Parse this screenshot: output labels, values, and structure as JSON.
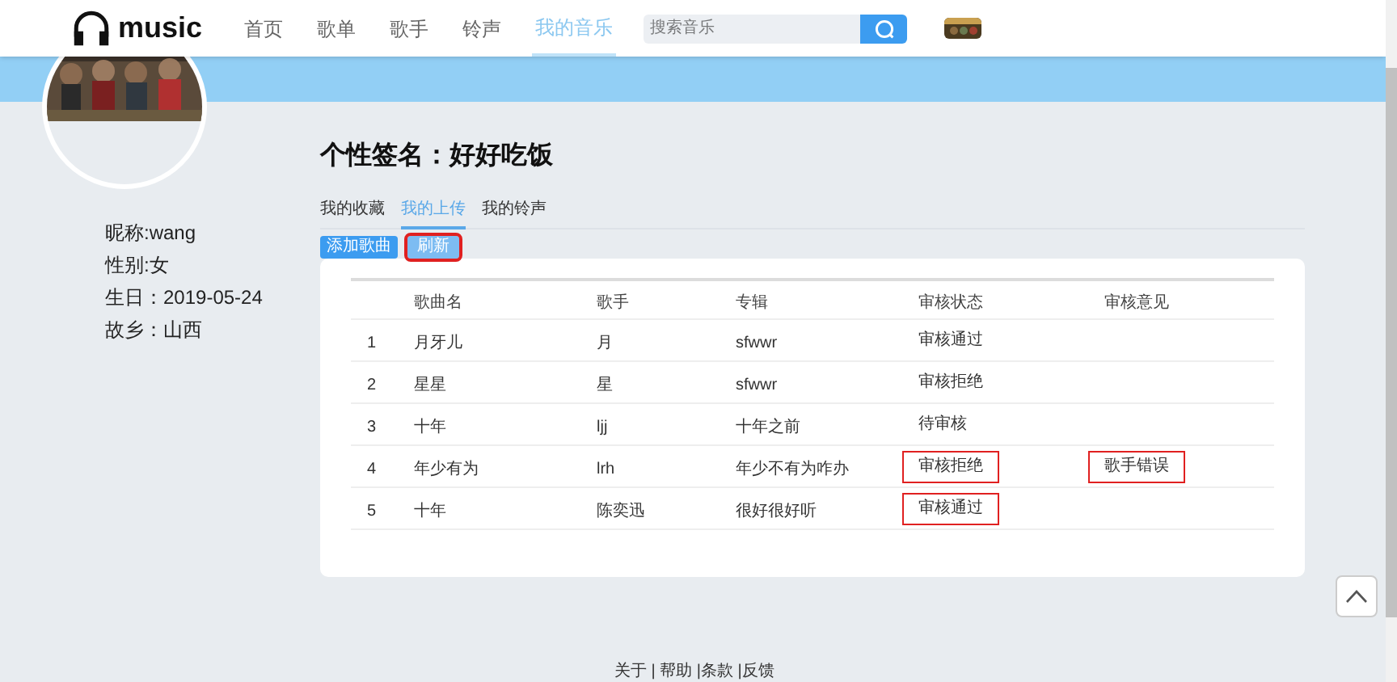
{
  "header": {
    "logo": "music",
    "nav": [
      {
        "label": "首页",
        "selected": false
      },
      {
        "label": "歌单",
        "selected": false
      },
      {
        "label": "歌手",
        "selected": false
      },
      {
        "label": "铃声",
        "selected": false
      },
      {
        "label": "我的音乐",
        "selected": true
      }
    ],
    "search": {
      "placeholder": "搜索音乐"
    }
  },
  "profile": {
    "details": [
      "昵称:wang",
      "性别:女",
      "生日：2019-05-24",
      "故乡：山西"
    ]
  },
  "signature": "个性签名：好好吃饭",
  "tabs": [
    {
      "label": "我的收藏",
      "selected": false
    },
    {
      "label": "我的上传",
      "selected": true
    },
    {
      "label": "我的铃声",
      "selected": false
    }
  ],
  "buttons": [
    {
      "label": "添加歌曲",
      "highlighted": false
    },
    {
      "label": "刷新",
      "highlighted": true
    }
  ],
  "table": {
    "columns": [
      "歌曲名",
      "歌手",
      "专辑",
      "审核状态",
      "审核意见"
    ],
    "rows": [
      {
        "index": "1",
        "name": "月牙儿",
        "singer": "月",
        "album": "sfwwr",
        "status": {
          "text": "审核通过",
          "highlighted": false
        }
      },
      {
        "index": "2",
        "name": "星星",
        "singer": "星",
        "album": "sfwwr",
        "status": {
          "text": "审核拒绝",
          "highlighted": false
        }
      },
      {
        "index": "3",
        "name": "十年",
        "singer": "ljj",
        "album": "十年之前",
        "status": {
          "text": "待审核",
          "highlighted": false
        }
      },
      {
        "index": "4",
        "name": "年少有为",
        "singer": "lrh",
        "album": "年少不有为咋办",
        "status": {
          "text": "审核拒绝",
          "highlighted": true
        },
        "opinion": {
          "text": "歌手错误",
          "highlighted": true
        }
      },
      {
        "index": "5",
        "name": "十年",
        "singer": "陈奕迅",
        "album": "很好很好听",
        "status": {
          "text": "审核通过",
          "highlighted": true
        }
      }
    ]
  },
  "footer": "关于 | 帮助 |条款 |反馈"
}
